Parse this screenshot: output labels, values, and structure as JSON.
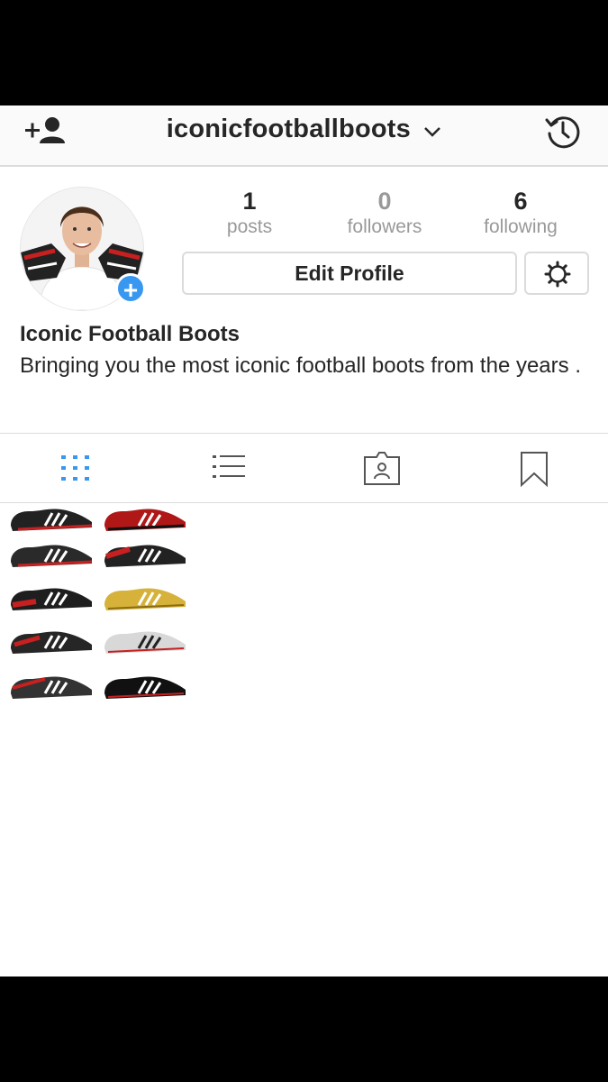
{
  "nav": {
    "username": "iconicfootballboots",
    "icons": [
      "add-user-icon",
      "chevron-down-icon",
      "history-icon"
    ]
  },
  "profile": {
    "avatar_badge": "+",
    "stats": [
      {
        "value": "1",
        "label": "posts"
      },
      {
        "value": "0",
        "label": "followers"
      },
      {
        "value": "6",
        "label": "following"
      }
    ],
    "edit_label": "Edit Profile",
    "full_name": "Iconic Football Boots",
    "bio": "Bringing you the most iconic football boots from the years ."
  },
  "tabs": [
    {
      "icon": "grid-icon",
      "active": true
    },
    {
      "icon": "list-icon",
      "active": false
    },
    {
      "icon": "tagged-photos-icon",
      "active": false
    },
    {
      "icon": "bookmark-icon",
      "active": false
    }
  ],
  "colors": {
    "accent": "#3897f0",
    "text": "#262626",
    "muted": "#999999",
    "border": "#dbdbdb"
  }
}
